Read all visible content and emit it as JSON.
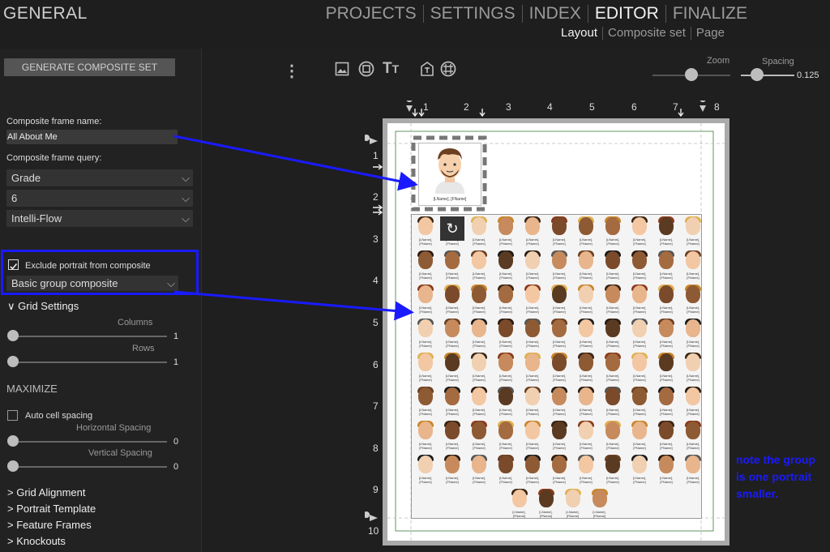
{
  "app": {
    "title": "GENERAL"
  },
  "nav": {
    "main": [
      "PROJECTS",
      "SETTINGS",
      "INDEX",
      "EDITOR",
      "FINALIZE"
    ],
    "active": "EDITOR",
    "sub": [
      "Layout",
      "Composite set",
      "Page"
    ],
    "sub_active": "Layout"
  },
  "left": {
    "generate_label": "GENERATE COMPOSITE SET",
    "frame_name_label": "Composite frame name:",
    "frame_name_value": "All About Me",
    "frame_query_label": "Composite frame query:",
    "query_selects": [
      "Grade",
      "6",
      "Intelli-Flow"
    ],
    "exclude_label": "Exclude portrait from composite",
    "exclude_checked": true,
    "composite_type": "Basic group composite",
    "grid_settings": "Grid Settings",
    "columns_label": "Columns",
    "columns_value": "1",
    "rows_label": "Rows",
    "rows_value": "1",
    "maximize": "MAXIMIZE",
    "auto_spacing_label": "Auto cell spacing",
    "h_spacing_label": "Horizontal Spacing",
    "h_spacing_value": "0",
    "v_spacing_label": "Vertical Spacing",
    "v_spacing_value": "0",
    "sections": [
      "Grid Alignment",
      "Portrait Template",
      "Feature Frames",
      "Knockouts"
    ]
  },
  "toolbar": {
    "menu_icon": "more-vertical-icon",
    "icons": [
      "image-icon",
      "frame-icon",
      "text-icon",
      "tag-icon",
      "grid-icon"
    ]
  },
  "zoom": {
    "label": "Zoom",
    "level": 0.5
  },
  "spacing": {
    "label": "Spacing",
    "value": "0.125",
    "level": 0.15
  },
  "ruler": {
    "h": [
      "1",
      "2",
      "3",
      "4",
      "5",
      "6",
      "7",
      "8"
    ],
    "v": [
      "1",
      "2",
      "3",
      "4",
      "5",
      "6",
      "7",
      "8",
      "9",
      "10"
    ]
  },
  "canvas": {
    "feature_caption": "[LName], [FName]",
    "cell_caption": "[LName],",
    "cell_caption2": "[FName]"
  },
  "note": "note the group is one portrait smaller.",
  "colors": {
    "accent": "#1a1aff",
    "panel": "#222222"
  }
}
